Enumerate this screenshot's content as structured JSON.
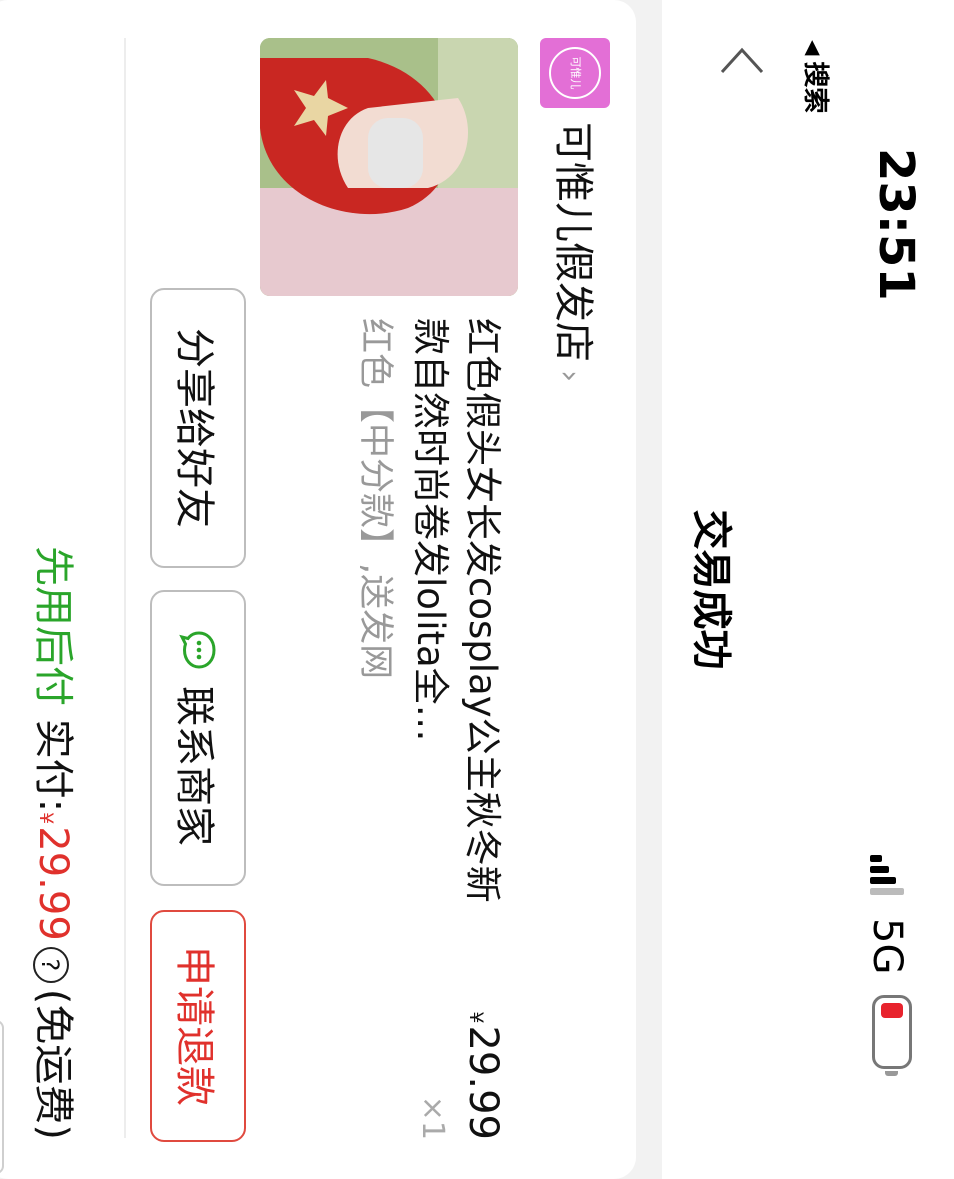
{
  "status_bar": {
    "time": "23:51",
    "back_to_app": "搜索",
    "network": "5G"
  },
  "header": {
    "title": "交易成功"
  },
  "order": {
    "shop": {
      "name": "可惟儿假发店",
      "logo_text": "可惟儿"
    },
    "item": {
      "title": "红色假头女长发cosplay公主秋冬新款自然时尚卷发lolita全…",
      "variant": "红色【中分款】,送发网",
      "price_symbol": "¥",
      "price": "29.99",
      "quantity": "×1"
    },
    "actions": {
      "share": "分享给好友",
      "contact": "联系商家",
      "refund": "申请退款"
    },
    "payment": {
      "pay_later": "先用后付",
      "paid_label": "实付:",
      "currency": "¥",
      "amount": "29.99",
      "shipping_note": "(免运费)"
    }
  },
  "colors": {
    "accent_red": "#e0312c",
    "accent_green": "#2aa52a",
    "shop_logo_bg": "#e36fd6"
  }
}
